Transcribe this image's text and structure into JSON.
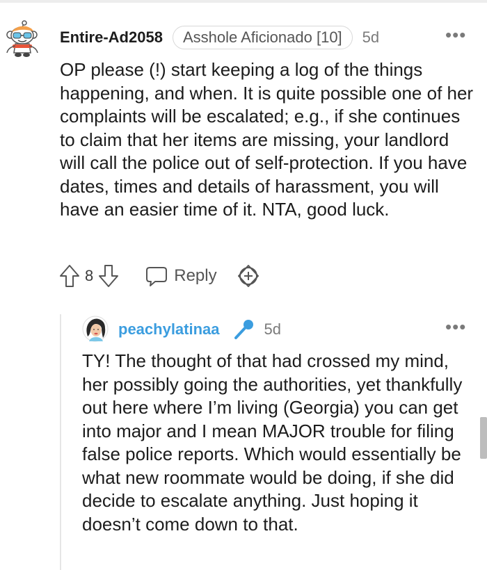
{
  "comments": [
    {
      "username": "Entire-Ad2058",
      "flair": "Asshole Aficionado [10]",
      "time": "5d",
      "body": "OP please (!) start keeping a log of the things happening, and when. It is quite possible one of her complaints will be escalated; e.g., if she continues to claim that her items are missing, your landlord will call the police out of self-protection. If you have dates, times and details of harassment, you will have an easier time of it. NTA, good luck.",
      "votes": "8",
      "reply_label": "Reply"
    },
    {
      "username": "peachylatinaa",
      "time": "5d",
      "body": "TY! The thought of that had crossed my mind, her possibly going the authorities, yet thankfully out here where I’m living (Georgia) you can get into major and I mean MAJOR trouble for filing false police reports. Which would essentially be what new roommate would be doing, if she did decide to escalate anything. Just hoping it doesn’t come down to that."
    }
  ],
  "icons": {
    "avatar_1": "snoo-avatar-icon",
    "upvote": "upvote-arrow-icon",
    "downvote": "downvote-arrow-icon",
    "reply": "speech-bubble-icon",
    "award": "award-plus-icon",
    "avatar_2": "user-avatar-icon",
    "op_badge": "microphone-icon",
    "more": "more-options-icon"
  },
  "colors": {
    "username_op": "#3b9ddf",
    "mic": "#3b9ddf",
    "text": "#1c1c1c",
    "meta": "#7a7a7a",
    "thread_line": "#e6e6e6"
  }
}
